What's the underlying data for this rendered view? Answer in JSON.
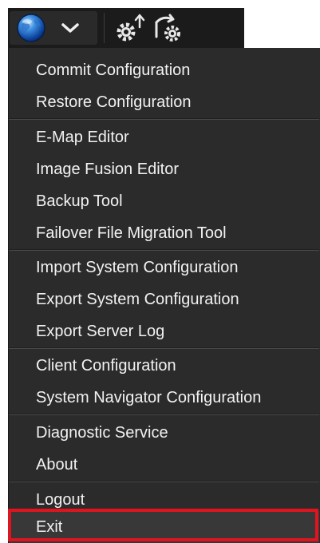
{
  "toolbar": {
    "icons": [
      "globe-icon",
      "chevron-down-icon",
      "config-upload-icon",
      "sync-settings-icon"
    ]
  },
  "menu": {
    "items": [
      {
        "label": "Commit Configuration"
      },
      {
        "label": "Restore Configuration"
      },
      {
        "label": "E-Map Editor"
      },
      {
        "label": "Image Fusion Editor"
      },
      {
        "label": "Backup Tool"
      },
      {
        "label": "Failover File Migration Tool"
      },
      {
        "label": "Import System Configuration"
      },
      {
        "label": "Export System Configuration"
      },
      {
        "label": "Export Server Log"
      },
      {
        "label": "Client Configuration"
      },
      {
        "label": "System Navigator Configuration"
      },
      {
        "label": "Diagnostic Service"
      },
      {
        "label": "About"
      },
      {
        "label": "Logout"
      },
      {
        "label": "Exit"
      }
    ]
  },
  "colors": {
    "menu_background": "#2b2b2b",
    "toolbar_background": "#1b1b1b",
    "highlight": "#e0141e",
    "text": "#f2f2f2"
  }
}
